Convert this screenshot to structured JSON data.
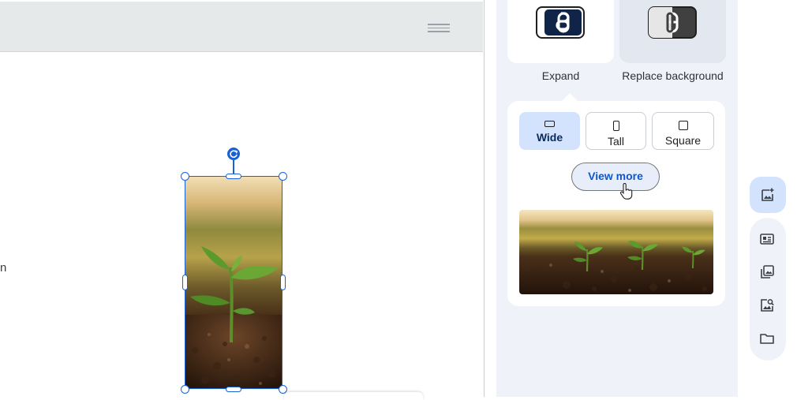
{
  "canvas": {
    "edge_text": "n"
  },
  "panel": {
    "tiles": [
      {
        "label": "Expand",
        "icon": "expand-icon"
      },
      {
        "label": "Replace background",
        "icon": "replace-background-icon"
      }
    ],
    "options": [
      {
        "label": "Wide",
        "icon": "wide-aspect-icon",
        "selected": true
      },
      {
        "label": "Tall",
        "icon": "tall-aspect-icon",
        "selected": false
      },
      {
        "label": "Square",
        "icon": "square-aspect-icon",
        "selected": false
      }
    ],
    "view_more_label": "View more"
  },
  "side_rail": {
    "items": [
      {
        "icon": "add-image-icon",
        "active": true
      },
      {
        "icon": "layout-icon",
        "active": false
      },
      {
        "icon": "gallery-icon",
        "active": false
      },
      {
        "icon": "image-search-icon",
        "active": false
      },
      {
        "icon": "folder-icon",
        "active": false
      }
    ]
  },
  "colors": {
    "accent": "#1a62d3",
    "selected_bg": "#d3e3fd",
    "panel_bg": "#eff3f9",
    "link_blue": "#0b57d0"
  }
}
